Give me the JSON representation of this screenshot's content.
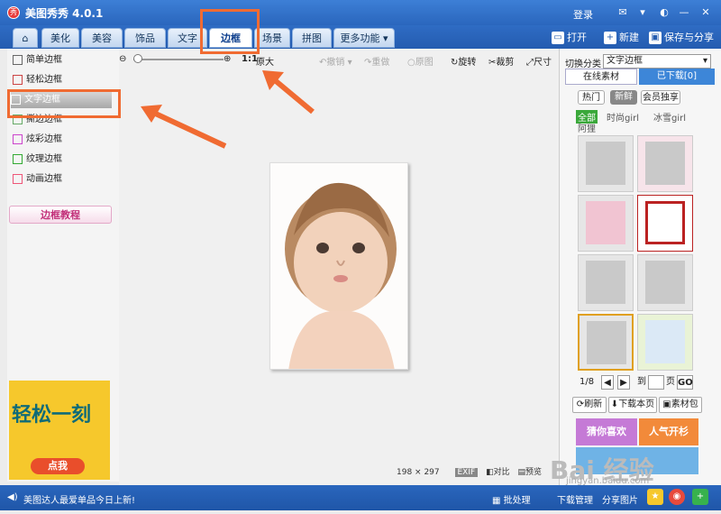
{
  "app": {
    "title": "美图秀秀 4.0.1",
    "login": "登录"
  },
  "tabs": [
    "美化",
    "美容",
    "饰品",
    "文字",
    "边框",
    "场景",
    "拼图",
    "更多功能"
  ],
  "active_tab": "边框",
  "toolbar_right": {
    "open": "打开",
    "new": "新建",
    "save_share": "保存与分享"
  },
  "left_menu": [
    "简单边框",
    "轻松边框",
    "文字边框",
    "撕边边框",
    "炫彩边框",
    "纹理边框",
    "动画边框"
  ],
  "left_selected": "文字边框",
  "tutorial_button": "边框教程",
  "ad": {
    "title": "轻松一刻",
    "button": "点我"
  },
  "canvas_toolbar": {
    "zoom_ratio": "1:1",
    "original": "原大",
    "undo": "撤销",
    "redo": "重做",
    "original_image": "原图",
    "rotate": "旋转",
    "crop": "裁剪",
    "size": "尺寸"
  },
  "image_info": {
    "dims": "198 × 297",
    "exif": "EXIF",
    "compare": "对比",
    "preview": "预览"
  },
  "right_panel": {
    "category_label": "切换分类",
    "category_value": "文字边框",
    "tab_online": "在线素材",
    "tab_downloaded": "已下载[0]",
    "filters": [
      "热门",
      "新鲜",
      "会员独享"
    ],
    "tags": [
      "全部",
      "时尚girl",
      "冰雪girl",
      "阿狸"
    ],
    "pagination": {
      "current": "1/8",
      "to": "到",
      "page": "页",
      "go": "GO"
    },
    "buttons": {
      "refresh": "刷新",
      "download_page": "下载本页",
      "material_pack": "素材包"
    },
    "banners": [
      "猜你喜欢",
      "人气开杉"
    ]
  },
  "statusbar": {
    "news": "美图达人最爱单品今日上新!",
    "batch": "批处理",
    "download_manager": "下载管理",
    "share": "分享图片"
  },
  "watermark": "Bai 经验",
  "watermark_url": "jingyan.baidu.com",
  "colors": {
    "accent": "#2a66bd",
    "highlight": "#f06b32",
    "gold": "#f6c82c"
  }
}
